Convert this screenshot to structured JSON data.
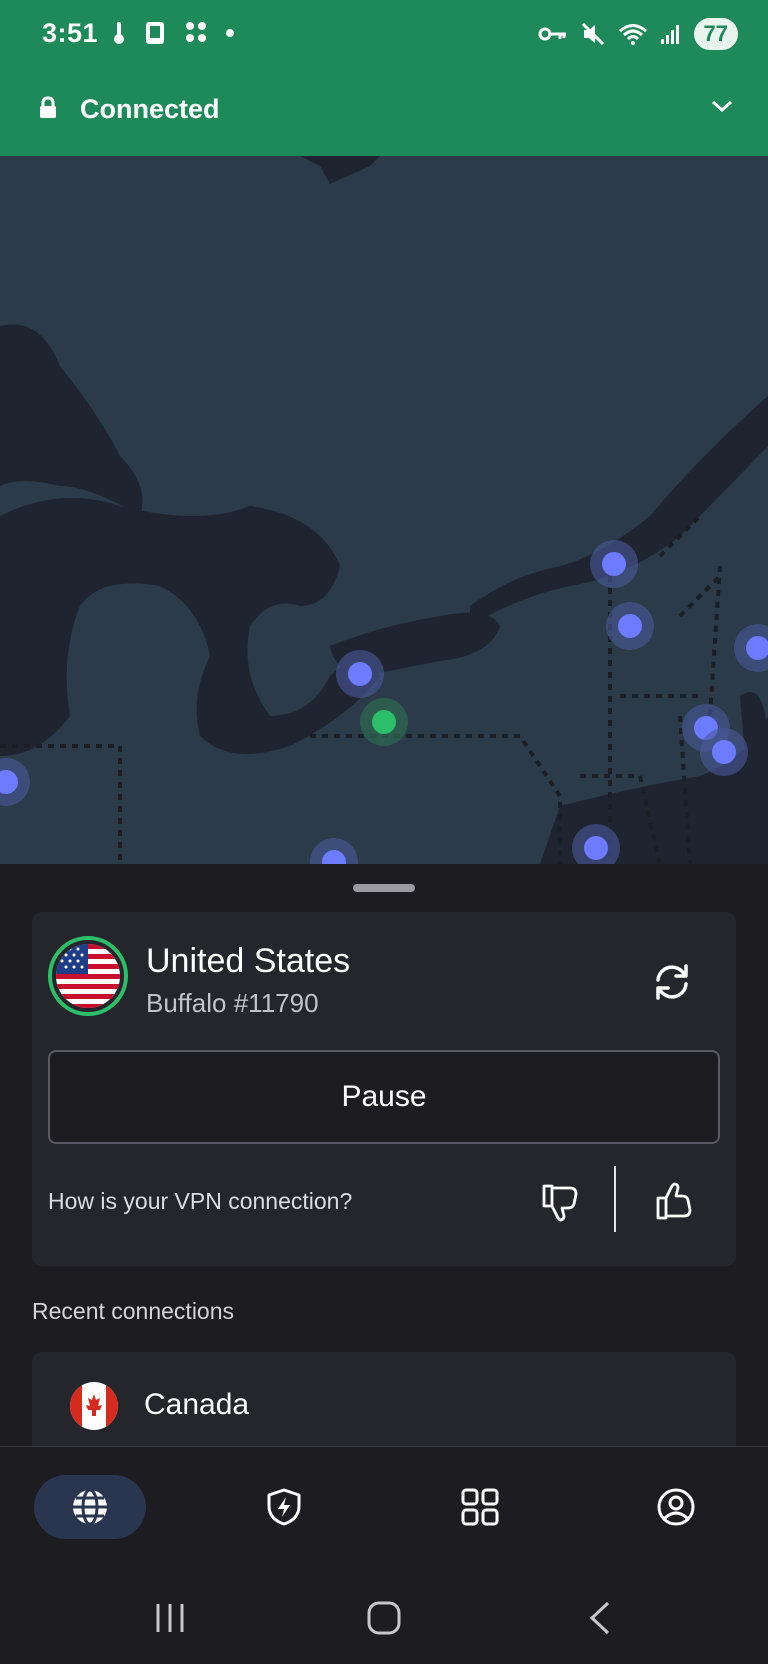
{
  "status_bar": {
    "time": "3:51",
    "battery": "77"
  },
  "connection": {
    "status": "Connected"
  },
  "current_server": {
    "country": "United States",
    "server": "Buffalo #11790",
    "pause_label": "Pause",
    "rating_question": "How is your VPN connection?"
  },
  "recent": {
    "title": "Recent connections",
    "items": [
      {
        "country": "Canada"
      }
    ]
  },
  "nav": {
    "items": [
      {
        "icon": "globe-icon",
        "active": true
      },
      {
        "icon": "shield-lightning-icon",
        "active": false
      },
      {
        "icon": "grid-icon",
        "active": false
      },
      {
        "icon": "profile-icon",
        "active": false
      }
    ]
  },
  "colors": {
    "brand_green": "#1f8a59",
    "server_pin": "#6c7bff",
    "connected_pin": "#2bbf6a"
  }
}
